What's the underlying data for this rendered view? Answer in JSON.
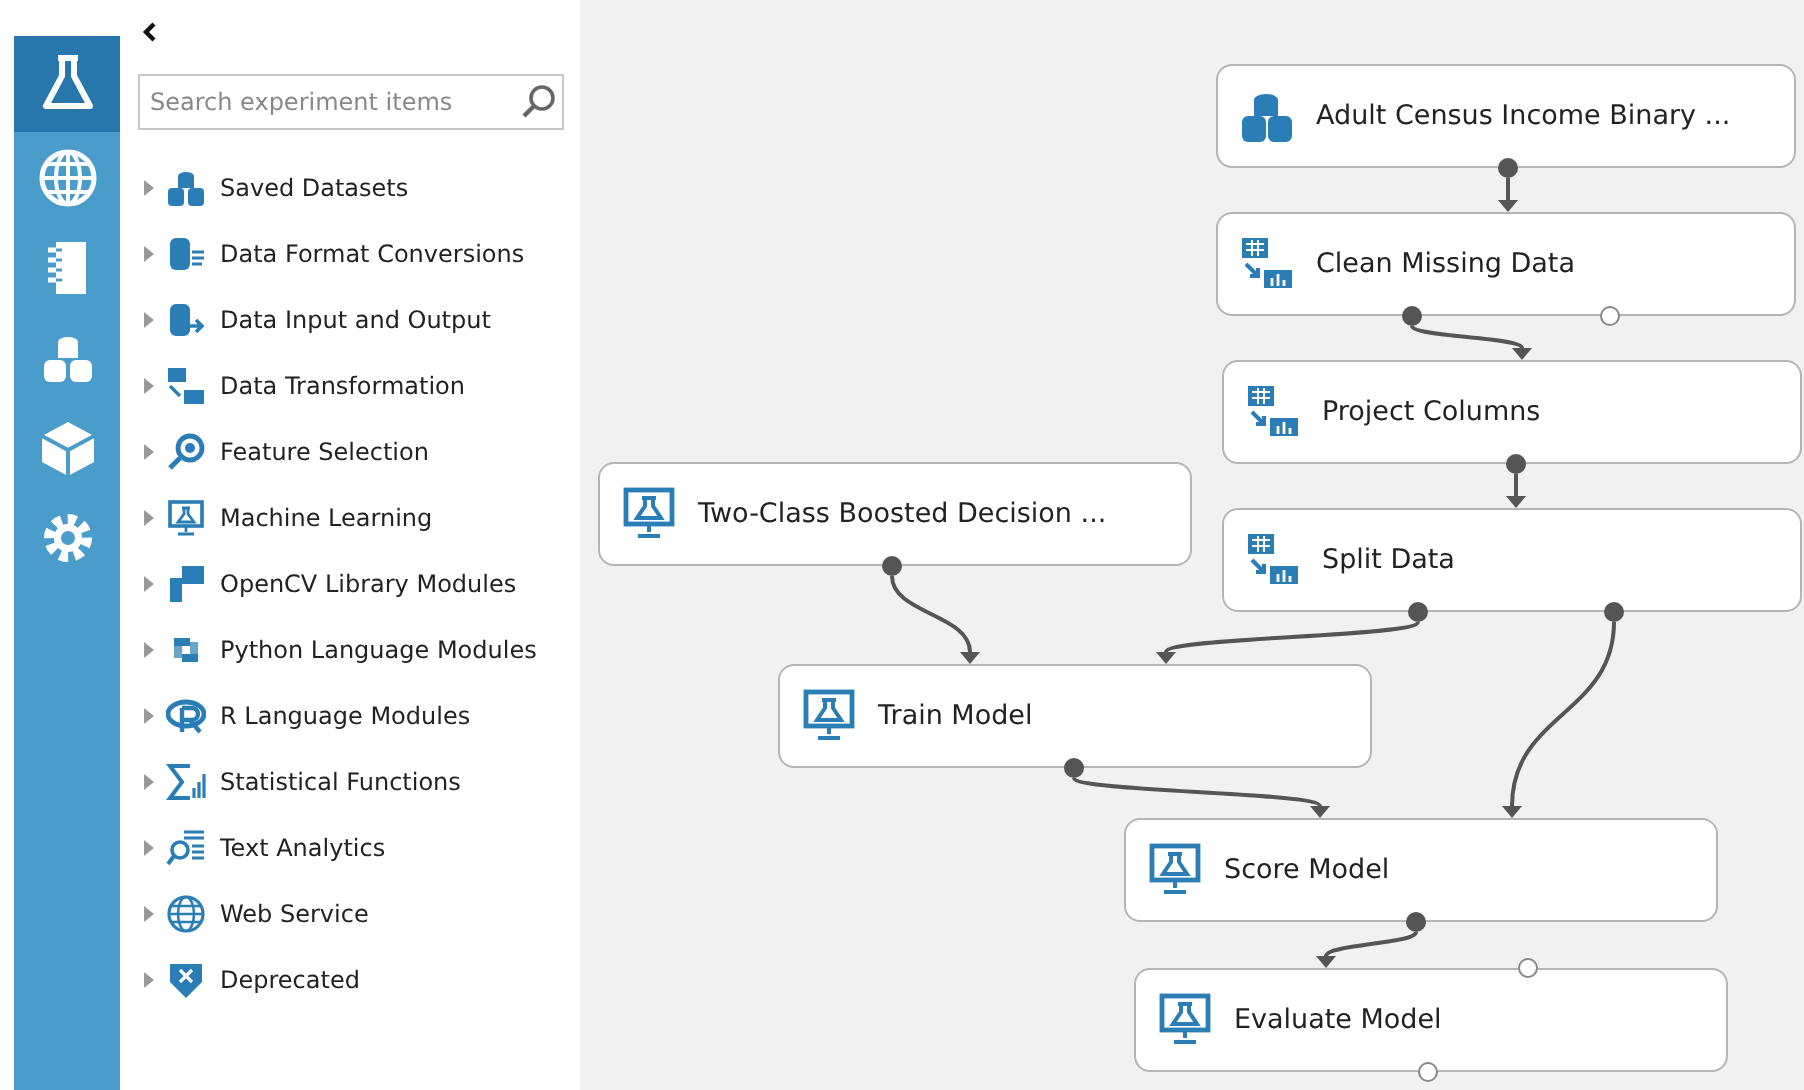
{
  "rail": [
    {
      "selected": true
    },
    {
      "selected": false
    },
    {
      "selected": false
    },
    {
      "selected": false
    },
    {
      "selected": false
    },
    {
      "selected": false
    }
  ],
  "search": {
    "placeholder": "Search experiment items"
  },
  "categories": [
    {
      "label": "Saved Datasets",
      "expanded": false
    },
    {
      "label": "Data Format Conversions",
      "expanded": false
    },
    {
      "label": "Data Input and Output",
      "expanded": false
    },
    {
      "label": "Data Transformation",
      "expanded": false
    },
    {
      "label": "Feature Selection",
      "expanded": false
    },
    {
      "label": "Machine Learning",
      "expanded": false
    },
    {
      "label": "OpenCV Library Modules",
      "expanded": false
    },
    {
      "label": "Python Language Modules",
      "expanded": false
    },
    {
      "label": "R Language Modules",
      "expanded": false
    },
    {
      "label": "Statistical Functions",
      "expanded": false
    },
    {
      "label": "Text Analytics",
      "expanded": false
    },
    {
      "label": "Web Service",
      "expanded": false
    },
    {
      "label": "Deprecated",
      "expanded": false
    }
  ],
  "canvas": {
    "nodes": [
      {
        "kind": "dataset",
        "label": "Adult Census Income Binary ...",
        "outputs": [
          {
            "connected": true
          }
        ]
      },
      {
        "kind": "transform",
        "label": "Clean Missing Data",
        "inputs": [
          {
            "connected": true
          }
        ],
        "outputs": [
          {
            "connected": true
          },
          {
            "connected": false
          }
        ]
      },
      {
        "kind": "transform",
        "label": "Project Columns",
        "inputs": [
          {
            "connected": true
          }
        ],
        "outputs": [
          {
            "connected": true
          }
        ]
      },
      {
        "kind": "transform",
        "label": "Split Data",
        "inputs": [
          {
            "connected": true
          }
        ],
        "outputs": [
          {
            "connected": true
          },
          {
            "connected": true
          }
        ]
      },
      {
        "kind": "model",
        "label": "Two-Class Boosted Decision ...",
        "outputs": [
          {
            "connected": true
          }
        ]
      },
      {
        "kind": "model",
        "label": "Train Model",
        "inputs": [
          {
            "connected": true
          },
          {
            "connected": true
          }
        ],
        "outputs": [
          {
            "connected": true
          }
        ]
      },
      {
        "kind": "model",
        "label": "Score Model",
        "inputs": [
          {
            "connected": true
          },
          {
            "connected": true
          }
        ],
        "outputs": [
          {
            "connected": true
          }
        ]
      },
      {
        "kind": "model",
        "label": "Evaluate Model",
        "inputs": [
          {
            "connected": true
          },
          {
            "connected": false
          }
        ],
        "outputs": [
          {
            "connected": false
          }
        ]
      }
    ]
  }
}
